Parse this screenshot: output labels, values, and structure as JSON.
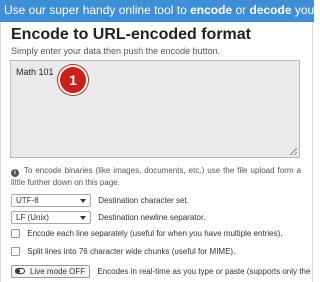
{
  "banner": {
    "prefix": "Use our super handy online tool to ",
    "encode": "encode",
    "middle": " or ",
    "decode": "decode",
    "suffix": " your data."
  },
  "header": {
    "title": "Encode to URL-encoded format",
    "subtitle": "Simply enter your data then push the encode button."
  },
  "input": {
    "value": "Math 101"
  },
  "annotation": {
    "badge": "1"
  },
  "info": {
    "icon": "i",
    "text": "To encode binaries (like images, documents, etc.) use the file upload form a little further down on this page."
  },
  "options": {
    "charset": {
      "value": "UTF-8",
      "label": "Destination character set."
    },
    "newline": {
      "value": "LF (Unix)",
      "label": "Destination newline separator."
    },
    "each_line": {
      "label": "Encode each line separately (useful for when you have multiple entries)."
    },
    "split_lines": {
      "label": "Split lines into 76 character wide chunks (useful for MIME)."
    },
    "live_mode": {
      "button": "Live mode OFF",
      "label": "Encodes in real-time as you type or paste (supports only the"
    }
  }
}
